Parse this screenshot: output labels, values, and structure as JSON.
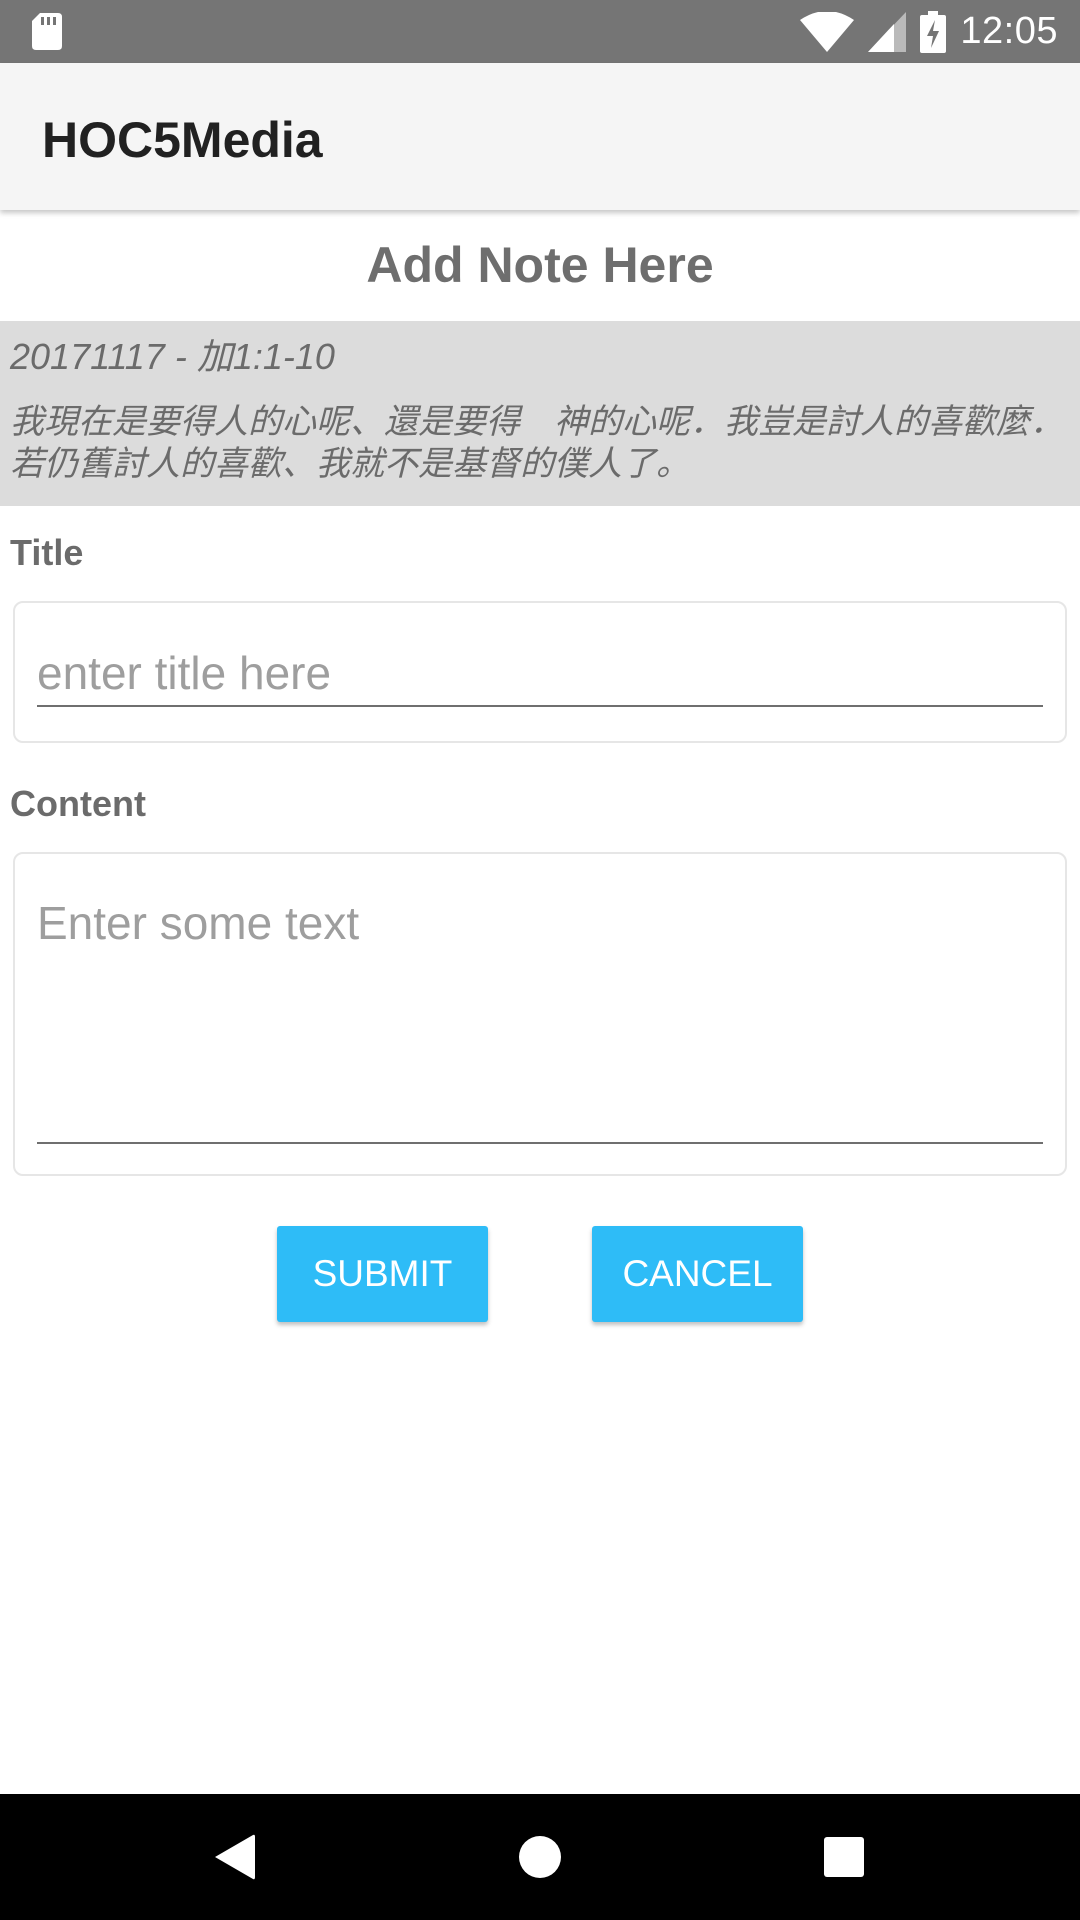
{
  "status_bar": {
    "time": "12:05",
    "icons": [
      "sd-card-icon",
      "wifi-icon",
      "signal-icon",
      "battery-charging-icon"
    ]
  },
  "app_bar": {
    "title": "HOC5Media"
  },
  "page": {
    "title": "Add Note Here"
  },
  "verse": {
    "reference": "20171117 - 加1:1-10",
    "text": "我現在是要得人的心呢、還是要得　神的心呢．我豈是討人的喜歡麼．若仍舊討人的喜歡、我就不是基督的僕人了。"
  },
  "form": {
    "title_label": "Title",
    "title_placeholder": "enter title here",
    "title_value": "",
    "content_label": "Content",
    "content_placeholder": "Enter some text",
    "content_value": ""
  },
  "actions": {
    "submit_label": "SUBMIT",
    "cancel_label": "CANCEL"
  },
  "colors": {
    "status_bar": "#757575",
    "app_bar": "#f5f5f5",
    "verse_background": "#dcdcdc",
    "button": "#2ebcf7",
    "nav_bar": "#000000"
  },
  "nav_bar": {
    "icons": [
      "back-icon",
      "home-icon",
      "recents-icon"
    ]
  }
}
